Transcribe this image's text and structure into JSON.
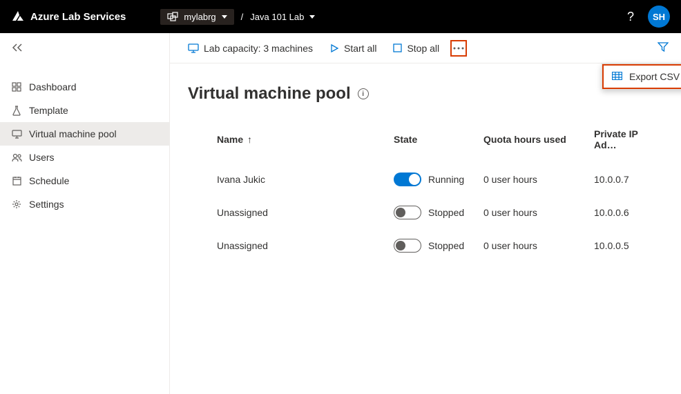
{
  "topbar": {
    "brand": "Azure Lab Services",
    "resource_group": "mylabrg",
    "separator": "/",
    "lab_name": "Java 101 Lab",
    "avatar_initials": "SH"
  },
  "sidebar": {
    "items": [
      {
        "label": "Dashboard",
        "icon": "dashboard-icon",
        "active": false
      },
      {
        "label": "Template",
        "icon": "flask-icon",
        "active": false
      },
      {
        "label": "Virtual machine pool",
        "icon": "screen-icon",
        "active": true
      },
      {
        "label": "Users",
        "icon": "users-icon",
        "active": false
      },
      {
        "label": "Schedule",
        "icon": "calendar-icon",
        "active": false
      },
      {
        "label": "Settings",
        "icon": "gear-icon",
        "active": false
      }
    ]
  },
  "toolbar": {
    "capacity_label": "Lab capacity: 3 machines",
    "start_all": "Start all",
    "stop_all": "Stop all",
    "more_menu": {
      "export_csv": "Export CSV"
    }
  },
  "page": {
    "title": "Virtual machine pool",
    "columns": {
      "name": "Name",
      "state": "State",
      "quota": "Quota hours used",
      "ip": "Private IP Ad…"
    },
    "rows": [
      {
        "name": "Ivana Jukic",
        "running": true,
        "state_label": "Running",
        "quota": "0 user hours",
        "ip": "10.0.0.7"
      },
      {
        "name": "Unassigned",
        "running": false,
        "state_label": "Stopped",
        "quota": "0 user hours",
        "ip": "10.0.0.6"
      },
      {
        "name": "Unassigned",
        "running": false,
        "state_label": "Stopped",
        "quota": "0 user hours",
        "ip": "10.0.0.5"
      }
    ]
  }
}
